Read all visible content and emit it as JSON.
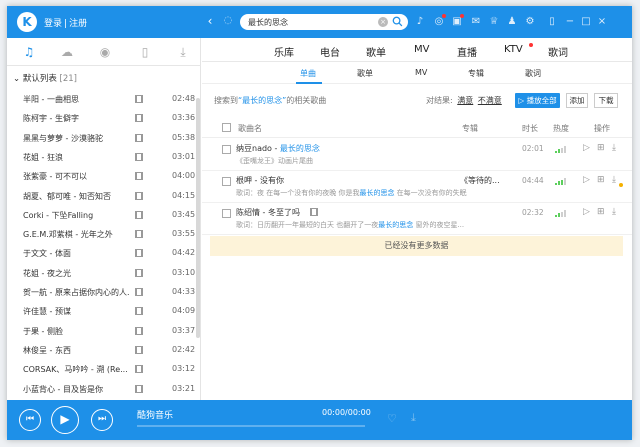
{
  "titlebar": {
    "logo": "K",
    "login": "登录",
    "sep": "|",
    "register": "注册",
    "search_value": "最长的思念",
    "icons": [
      "mic-icon",
      "game-icon",
      "gift-icon",
      "message-icon",
      "skin-icon",
      "settings-icon",
      "mini-mode-icon",
      "minimize-icon",
      "maximize-icon",
      "close-icon"
    ]
  },
  "sidebar": {
    "tabs": [
      "music-note-icon",
      "cloud-icon",
      "radio-icon",
      "device-icon",
      "download-icon"
    ],
    "playlist_name": "默认列表",
    "playlist_count": "[21]",
    "songs": [
      {
        "name": "半阳 - 一曲相思",
        "duration": "02:48"
      },
      {
        "name": "陈柯宇 - 生僻字",
        "duration": "03:36"
      },
      {
        "name": "黑黑与萝萝 - 沙漠骆驼",
        "duration": "05:38"
      },
      {
        "name": "花姐 - 狂浪",
        "duration": "03:01"
      },
      {
        "name": "张紫豪 - 可不可以",
        "duration": "04:00"
      },
      {
        "name": "胡夏、郁可唯 - 知否知否",
        "duration": "04:15"
      },
      {
        "name": "Corki - 下坠Falling",
        "duration": "03:45"
      },
      {
        "name": "G.E.M.邓紫棋 - 光年之外",
        "duration": "03:55"
      },
      {
        "name": "于文文 - 体面",
        "duration": "04:42"
      },
      {
        "name": "花姐 - 夜之光",
        "duration": "03:10"
      },
      {
        "name": "贺一航 - 原来占据你内心的人...",
        "duration": "04:33"
      },
      {
        "name": "许佳慧 - 预谋",
        "duration": "04:09"
      },
      {
        "name": "于果 - 侧脸",
        "duration": "03:37"
      },
      {
        "name": "林俊呈 - 东西",
        "duration": "02:42"
      },
      {
        "name": "CORSAK、马吟吟 - 溯 (Re...",
        "duration": "03:12"
      },
      {
        "name": "小蓝背心 - 目及皆是你",
        "duration": "03:21"
      }
    ]
  },
  "player": {
    "brand": "酷狗音乐",
    "time": "00:00/00:00"
  },
  "main": {
    "nav": [
      "乐库",
      "电台",
      "歌单",
      "MV",
      "直播",
      "KTV",
      "歌词"
    ],
    "subtabs": [
      "单曲",
      "歌单",
      "MV",
      "专辑",
      "歌词"
    ],
    "result_prefix": "搜索到",
    "result_keyword": "“最长的思念”",
    "result_suffix": "的相关歌曲",
    "satisfy_label": "对结果:",
    "satisfied": "满意",
    "unsatisfied": "不满意",
    "play_all": "▷ 播放全部",
    "add": "添加",
    "download": "下载",
    "columns": [
      "歌曲名",
      "专辑",
      "时长",
      "热度",
      "操作"
    ],
    "results": [
      {
        "title_pre": "纳豆nado - ",
        "title_kw": "最长的思念",
        "sub": "《歪嘴龙王》动画片尾曲",
        "sub_pre": "",
        "sub_kw": "",
        "sub_post": "",
        "album": "",
        "time": "02:01",
        "heat": 2
      },
      {
        "title_pre": "根呷 - 没有你",
        "title_kw": "",
        "sub": "",
        "sub_pre": "歌词：夜 在每一个没有你的夜晚 你是我",
        "sub_kw": "最长的思念",
        "sub_post": " 在每一次没有你的失眠",
        "album": "《等待的...",
        "time": "04:44",
        "heat": 3
      },
      {
        "title_pre": "陈绍情 - 冬至了吗",
        "title_kw": "",
        "sub": "",
        "sub_pre": "歌词：日历翻开一年最短的白天 也翻开了一夜",
        "sub_kw": "最长的思念",
        "sub_post": " 窗外的夜空星...",
        "album": "",
        "time": "02:32",
        "heat": 2
      }
    ],
    "no_more": "已经没有更多数据"
  },
  "colors": {
    "accent": "#1e90e8",
    "highlight_bg": "#fdf3d9",
    "heat_on": "#5ccf5c",
    "badge_red": "#ff3333"
  }
}
